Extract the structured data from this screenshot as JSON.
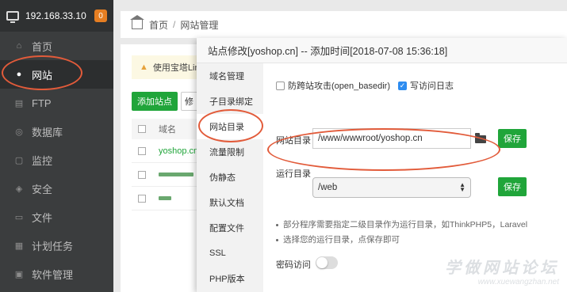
{
  "sidebar": {
    "server_ip": "192.168.33.10",
    "badge": "0",
    "items": [
      {
        "label": "首页",
        "icon": "home-icon"
      },
      {
        "label": "网站",
        "icon": "globe-icon"
      },
      {
        "label": "FTP",
        "icon": "ftp-icon"
      },
      {
        "label": "数据库",
        "icon": "database-icon"
      },
      {
        "label": "监控",
        "icon": "monitor-icon"
      },
      {
        "label": "安全",
        "icon": "shield-icon"
      },
      {
        "label": "文件",
        "icon": "folder-icon"
      },
      {
        "label": "计划任务",
        "icon": "calendar-icon"
      },
      {
        "label": "软件管理",
        "icon": "apps-icon"
      }
    ]
  },
  "breadcrumb": {
    "home": "首页",
    "separator": "/",
    "current": "网站管理"
  },
  "background": {
    "warning_text": "使用宝塔Linu",
    "add_site_button": "添加站点",
    "edit_button": "修",
    "table_header": "域名",
    "rows": [
      "yoshop.cn"
    ]
  },
  "modal": {
    "title": "站点修改[yoshop.cn] -- 添加时间[2018-07-08 15:36:18]",
    "nav": [
      "域名管理",
      "子目录绑定",
      "网站目录",
      "流量限制",
      "伪静态",
      "默认文档",
      "配置文件",
      "SSL",
      "PHP版本"
    ],
    "anti_xss_label": "防跨站攻击(open_basedir)",
    "access_log_label": "写访问日志",
    "site_dir_label": "网站目录",
    "site_dir_value": "/www/wwwroot/yoshop.cn",
    "save_label": "保存",
    "run_dir_label": "运行目录",
    "run_dir_value": "/web",
    "tip1": "部分程序需要指定二级目录作为运行目录，如ThinkPHP5，Laravel",
    "tip2": "选择您的运行目录，点保存即可",
    "password_access_label": "密码访问"
  },
  "watermark": {
    "title": "学做网站论坛",
    "url": "www.xuewangzhan.net"
  },
  "colors": {
    "accent_green": "#20a53a",
    "annotation_red": "#e25b3a",
    "sidebar_bg": "#3b3d3e"
  }
}
